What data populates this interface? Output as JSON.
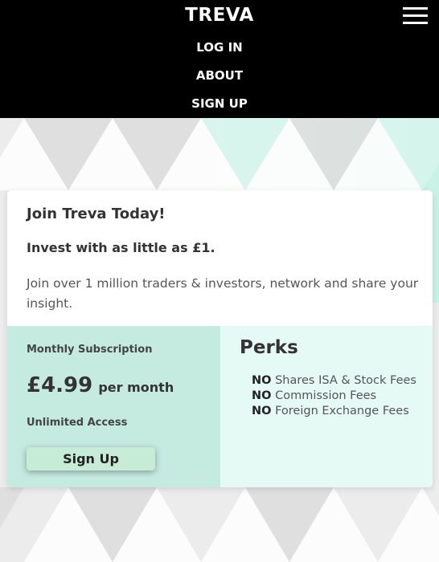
{
  "header": {
    "brand": "TREVA",
    "nav": {
      "login": "LOG IN",
      "about": "ABOUT",
      "signup": "SIGN UP"
    },
    "menu_icon": "hamburger-menu-icon"
  },
  "card": {
    "title": "Join Treva Today!",
    "subtitle": "Invest with as little as £1.",
    "description": "Join over 1 million traders & investors, network and share your insight.",
    "plan": {
      "label": "Monthly Subscription",
      "price": "£4.99",
      "period": "per month",
      "access": "Unlimited Access",
      "button": "Sign Up"
    },
    "perks": {
      "title": "Perks",
      "items": [
        {
          "prefix": "NO",
          "text": "Shares ISA & Stock Fees"
        },
        {
          "prefix": "NO",
          "text": "Commission Fees"
        },
        {
          "prefix": "NO",
          "text": "Foreign Exchange Fees"
        }
      ]
    }
  },
  "colors": {
    "header_bg": "#000000",
    "pane_left": "#c5ebe1",
    "pane_right": "#e5faf4",
    "button_bg": "#c6ecd7"
  }
}
